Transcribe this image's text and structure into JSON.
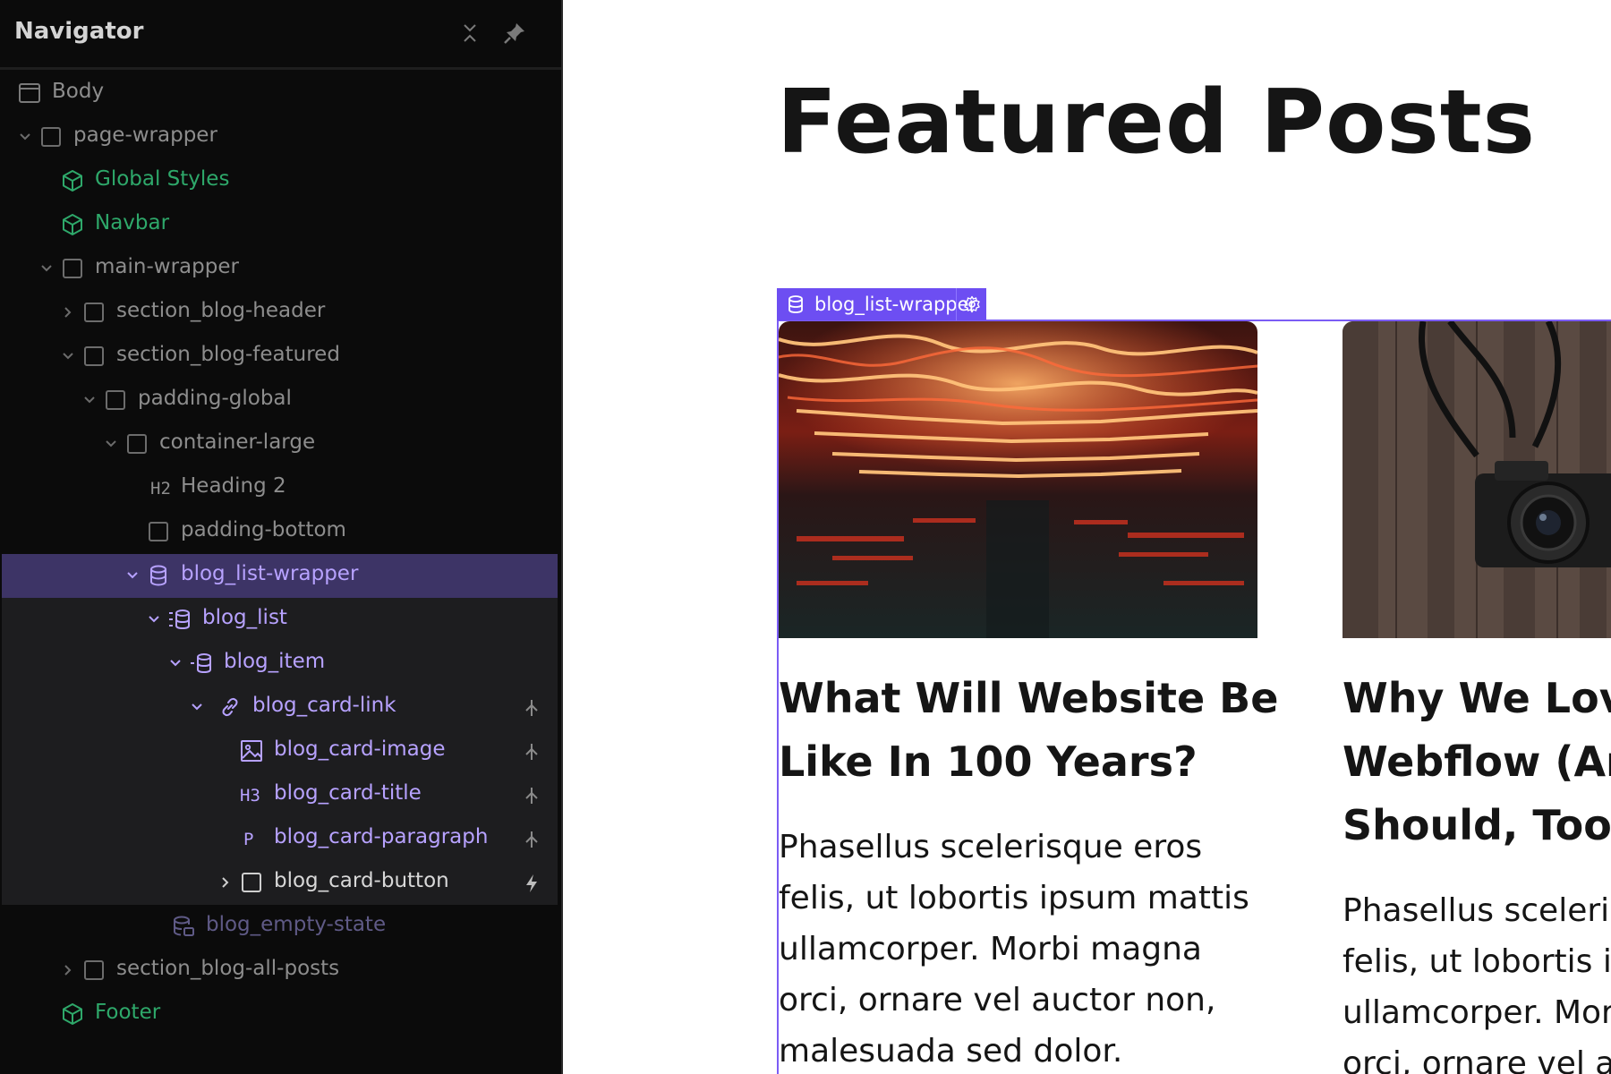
{
  "navigator": {
    "title": "Navigator",
    "items": [
      {
        "label": "Body"
      },
      {
        "label": "page-wrapper"
      },
      {
        "label": "Global Styles"
      },
      {
        "label": "Navbar"
      },
      {
        "label": "main-wrapper"
      },
      {
        "label": "section_blog-header"
      },
      {
        "label": "section_blog-featured"
      },
      {
        "label": "padding-global"
      },
      {
        "label": "container-large"
      },
      {
        "label": "Heading 2",
        "tag": "H2"
      },
      {
        "label": "padding-bottom"
      },
      {
        "label": "blog_list-wrapper"
      },
      {
        "label": "blog_list"
      },
      {
        "label": "blog_item"
      },
      {
        "label": "blog_card-link"
      },
      {
        "label": "blog_card-image"
      },
      {
        "label": "blog_card-title",
        "tag": "H3"
      },
      {
        "label": "blog_card-paragraph",
        "tag": "P"
      },
      {
        "label": "blog_card-button"
      },
      {
        "label": "blog_empty-state"
      },
      {
        "label": "section_blog-all-posts"
      },
      {
        "label": "Footer"
      }
    ]
  },
  "canvas": {
    "heading": "Featured Posts",
    "selection_label": "blog_list-wrapper",
    "cards": [
      {
        "title_lines": [
          "What Will Website Be",
          "Like In 100 Years?"
        ],
        "paragraph_lines": [
          "Phasellus scelerisque eros",
          "felis, ut lobortis ipsum mattis",
          "ullamcorper. Morbi magna",
          "orci, ornare vel auctor non,",
          "malesuada sed dolor."
        ]
      },
      {
        "title_lines": [
          "Why We Love",
          "Webflow (An",
          "Should, Too!)"
        ],
        "paragraph_lines": [
          "Phasellus sceleris",
          "felis, ut lobortis ip",
          "ullamcorper. Mor",
          "orci, ornare vel au"
        ]
      }
    ]
  },
  "colors": {
    "panel_bg": "#0b0b0b",
    "selected_row": "#3d3466",
    "symbol_green": "#2ea86a",
    "collection_purple": "#b7a2ff",
    "selection_accent": "#6d4ef2"
  }
}
